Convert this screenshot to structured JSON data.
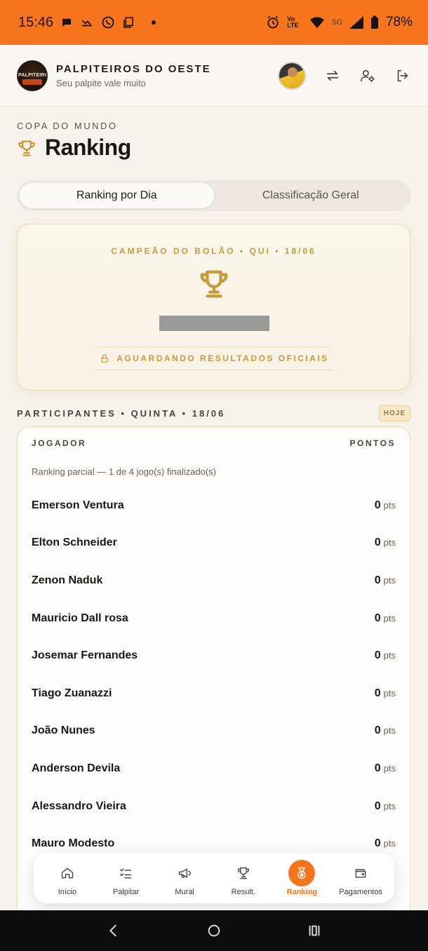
{
  "status_bar": {
    "time": "15:46",
    "battery": "78%",
    "network": "5G",
    "lte": "Vo LTE"
  },
  "header": {
    "brand_title": "PALPITEIROS DO OESTE",
    "brand_subtitle": "Seu palpite vale muito",
    "logo_text": "PALPITEIROS"
  },
  "page": {
    "eyebrow": "COPA DO MUNDO",
    "title": "Ranking"
  },
  "tabs": [
    {
      "label": "Ranking por Dia",
      "active": true
    },
    {
      "label": "Classificação Geral",
      "active": false
    }
  ],
  "champion": {
    "eyebrow": "CAMPEÃO DO BOLÃO • QUI • 18/06",
    "status": "AGUARDANDO RESULTADOS OFICIAIS"
  },
  "participants": {
    "title": "PARTICIPANTES • QUINTA • 18/06",
    "badge": "HOJE",
    "col_player": "JOGADOR",
    "col_points": "PONTOS",
    "note": "Ranking parcial — 1 de 4 jogo(s) finalizado(s)",
    "unit": "pts",
    "rows": [
      {
        "name": "Emerson Ventura",
        "points": "0"
      },
      {
        "name": "Elton Schneider",
        "points": "0"
      },
      {
        "name": "Zenon Naduk",
        "points": "0"
      },
      {
        "name": "Mauricio Dall rosa",
        "points": "0"
      },
      {
        "name": "Josemar Fernandes",
        "points": "0"
      },
      {
        "name": "Tiago Zuanazzi",
        "points": "0"
      },
      {
        "name": "João Nunes",
        "points": "0"
      },
      {
        "name": "Anderson Devila",
        "points": "0"
      },
      {
        "name": "Alessandro Vieira",
        "points": "0"
      },
      {
        "name": "Mauro Modesto",
        "points": "0"
      }
    ]
  },
  "bottom_nav": [
    {
      "label": "Início",
      "icon": "home-icon",
      "active": false
    },
    {
      "label": "Palpitar",
      "icon": "checklist-icon",
      "active": false
    },
    {
      "label": "Mural",
      "icon": "megaphone-icon",
      "active": false
    },
    {
      "label": "Result.",
      "icon": "trophy-icon",
      "active": false
    },
    {
      "label": "Ranking",
      "icon": "medal-icon",
      "active": true
    },
    {
      "label": "Pagamentos",
      "icon": "wallet-icon",
      "active": false
    }
  ],
  "colors": {
    "accent": "#f2741c",
    "gold": "#c99a3a",
    "status_bar": "#f7751c"
  }
}
